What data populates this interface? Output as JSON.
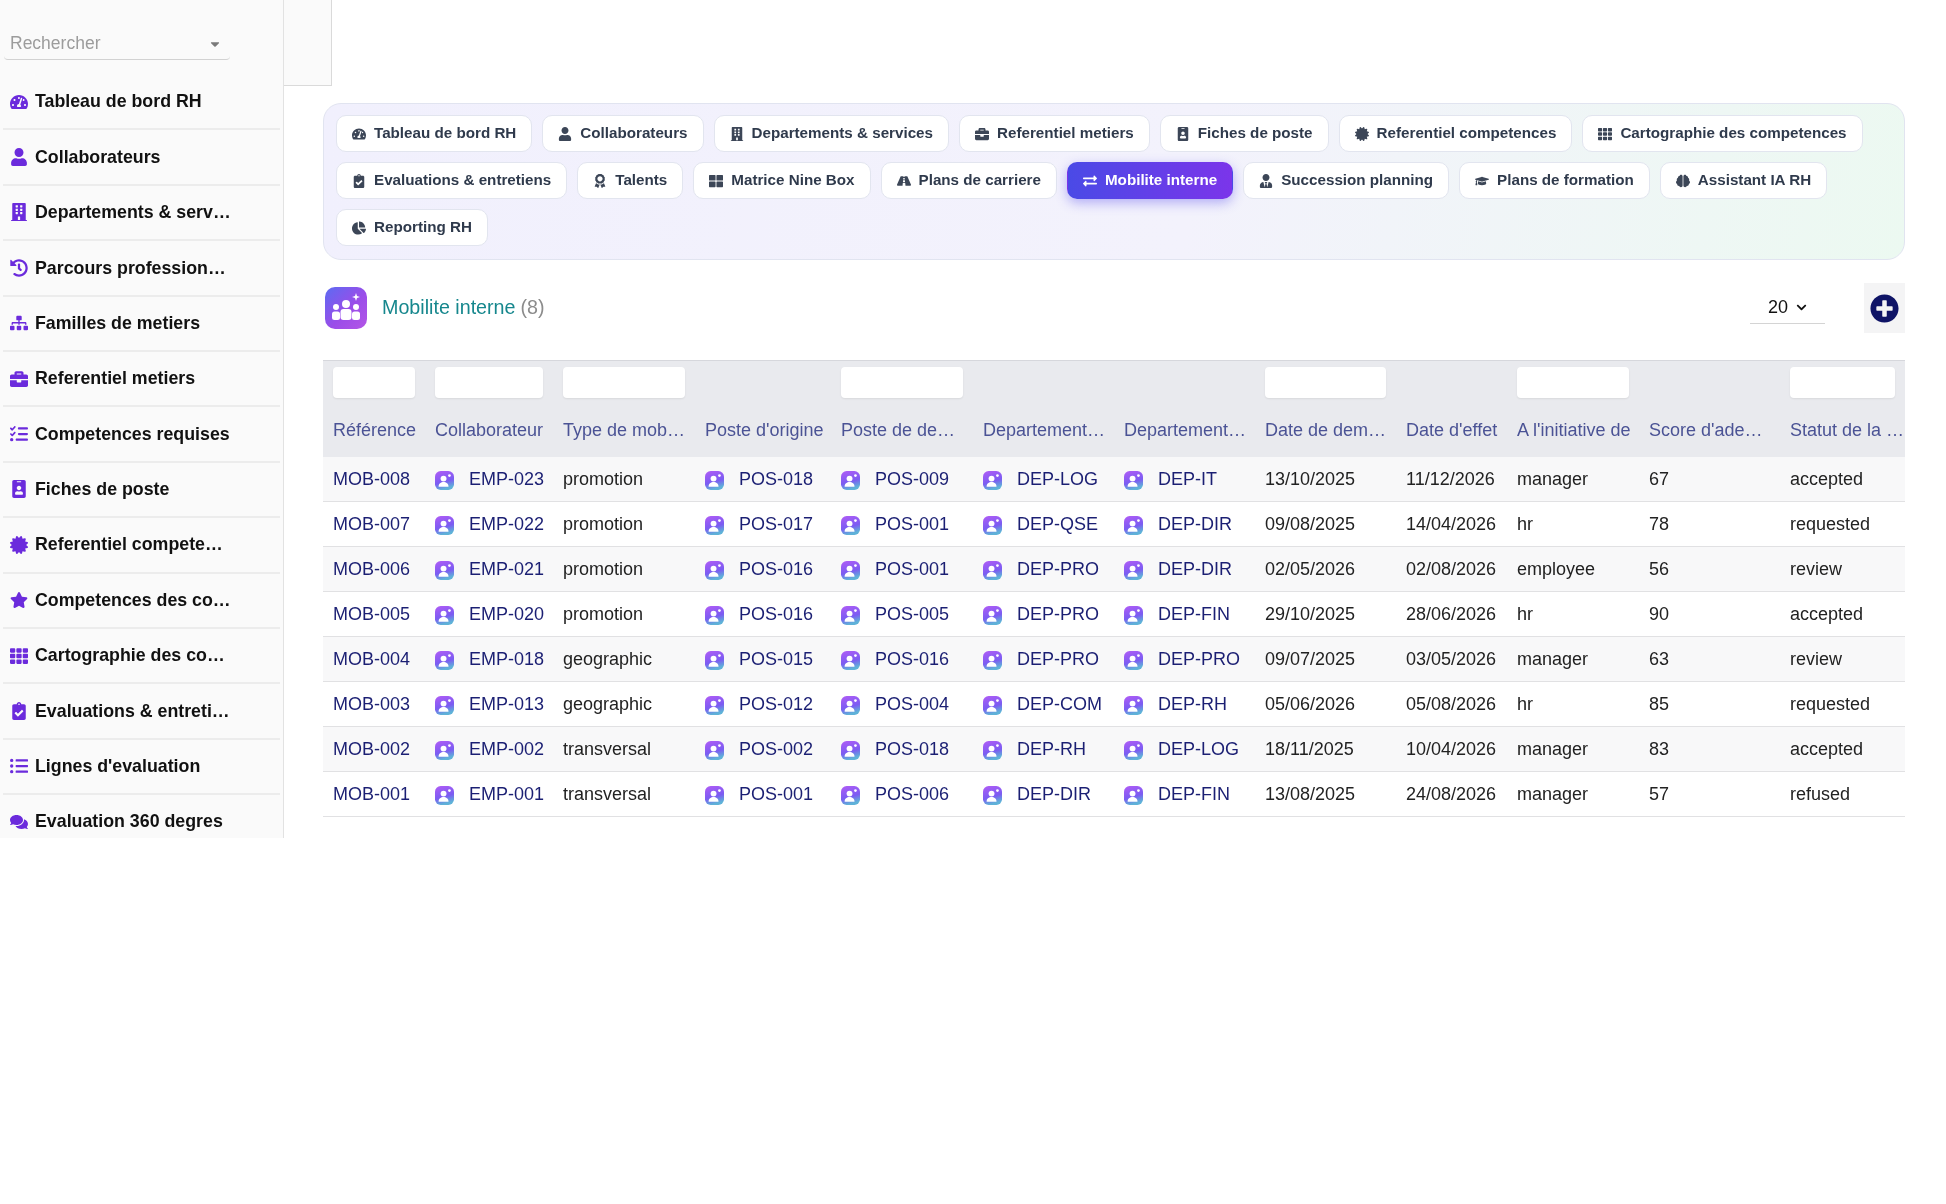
{
  "sidebar": {
    "search": {
      "placeholder": "Rechercher"
    },
    "items": [
      {
        "label": "Tableau de bord RH"
      },
      {
        "label": "Collaborateurs"
      },
      {
        "label": "Departements & serv…"
      },
      {
        "label": "Parcours profession…"
      },
      {
        "label": "Familles de metiers"
      },
      {
        "label": "Referentiel metiers"
      },
      {
        "label": "Competences requises"
      },
      {
        "label": "Fiches de poste"
      },
      {
        "label": "Referentiel compete…"
      },
      {
        "label": "Competences des co…"
      },
      {
        "label": "Cartographie des co…"
      },
      {
        "label": "Evaluations & entreti…"
      },
      {
        "label": "Lignes d'evaluation"
      },
      {
        "label": "Evaluation 360 degres"
      }
    ]
  },
  "nav_tabs": {
    "rows": [
      {
        "tabs": [
          {
            "label": "Tableau de bord RH",
            "selected": false
          },
          {
            "label": "Collaborateurs",
            "selected": false
          },
          {
            "label": "Departements & services",
            "selected": false
          },
          {
            "label": "Referentiel metiers",
            "selected": false
          },
          {
            "label": "Fiches de poste",
            "selected": false
          },
          {
            "label": "Referentiel competences",
            "selected": false
          },
          {
            "label": "Cartographie des competences",
            "selected": false
          }
        ]
      },
      {
        "tabs": [
          {
            "label": "Evaluations & entretiens",
            "selected": false
          },
          {
            "label": "Talents",
            "selected": false
          },
          {
            "label": "Matrice Nine Box",
            "selected": false
          },
          {
            "label": "Plans de carriere",
            "selected": false
          },
          {
            "label": "Mobilite interne",
            "selected": true
          },
          {
            "label": "Succession planning",
            "selected": false
          },
          {
            "label": "Plans de formation",
            "selected": false
          },
          {
            "label": "Assistant IA RH",
            "selected": false
          }
        ]
      },
      {
        "tabs": [
          {
            "label": "Reporting RH",
            "selected": false
          }
        ]
      }
    ]
  },
  "page": {
    "title": "Mobilite interne",
    "count": "(8)",
    "page_size": "20"
  },
  "table": {
    "columns": [
      {
        "label": "Référence",
        "filter": true,
        "kind": "link"
      },
      {
        "label": "Collaborateur",
        "filter": true,
        "kind": "link_icon"
      },
      {
        "label": "Type de mob…",
        "filter": true,
        "kind": "text"
      },
      {
        "label": "Poste d'origine",
        "filter": false,
        "kind": "link_icon"
      },
      {
        "label": "Poste de de…",
        "filter": true,
        "kind": "link_icon"
      },
      {
        "label": "Departement…",
        "filter": false,
        "kind": "link_icon"
      },
      {
        "label": "Departement…",
        "filter": false,
        "kind": "link_icon"
      },
      {
        "label": "Date de dem…",
        "filter": true,
        "kind": "text"
      },
      {
        "label": "Date d'effet",
        "filter": false,
        "kind": "text"
      },
      {
        "label": "A l'initiative de",
        "filter": true,
        "kind": "text"
      },
      {
        "label": "Score d'ade…",
        "filter": false,
        "kind": "text"
      },
      {
        "label": "Statut de la …",
        "filter": true,
        "kind": "text"
      }
    ],
    "rows": [
      [
        "MOB-008",
        "EMP-023",
        "promotion",
        "POS-018",
        "POS-009",
        "DEP-LOG",
        "DEP-IT",
        "13/10/2025",
        "11/12/2026",
        "manager",
        "67",
        "accepted"
      ],
      [
        "MOB-007",
        "EMP-022",
        "promotion",
        "POS-017",
        "POS-001",
        "DEP-QSE",
        "DEP-DIR",
        "09/08/2025",
        "14/04/2026",
        "hr",
        "78",
        "requested"
      ],
      [
        "MOB-006",
        "EMP-021",
        "promotion",
        "POS-016",
        "POS-001",
        "DEP-PRO",
        "DEP-DIR",
        "02/05/2026",
        "02/08/2026",
        "employee",
        "56",
        "review"
      ],
      [
        "MOB-005",
        "EMP-020",
        "promotion",
        "POS-016",
        "POS-005",
        "DEP-PRO",
        "DEP-FIN",
        "29/10/2025",
        "28/06/2026",
        "hr",
        "90",
        "accepted"
      ],
      [
        "MOB-004",
        "EMP-018",
        "geographic",
        "POS-015",
        "POS-016",
        "DEP-PRO",
        "DEP-PRO",
        "09/07/2025",
        "03/05/2026",
        "manager",
        "63",
        "review"
      ],
      [
        "MOB-003",
        "EMP-013",
        "geographic",
        "POS-012",
        "POS-004",
        "DEP-COM",
        "DEP-RH",
        "05/06/2026",
        "05/08/2026",
        "hr",
        "85",
        "requested"
      ],
      [
        "MOB-002",
        "EMP-002",
        "transversal",
        "POS-002",
        "POS-018",
        "DEP-RH",
        "DEP-LOG",
        "18/11/2025",
        "10/04/2026",
        "manager",
        "83",
        "accepted"
      ],
      [
        "MOB-001",
        "EMP-001",
        "transversal",
        "POS-001",
        "POS-006",
        "DEP-DIR",
        "DEP-FIN",
        "13/08/2025",
        "24/08/2026",
        "manager",
        "57",
        "refused"
      ]
    ]
  }
}
